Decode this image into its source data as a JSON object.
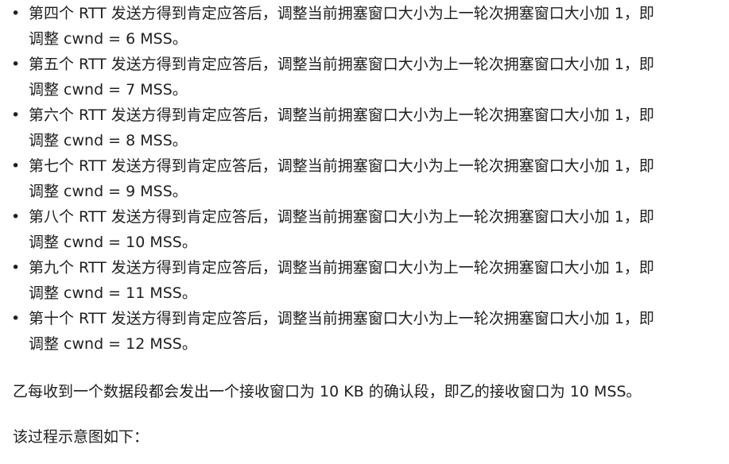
{
  "bullet_glyph": "•",
  "items": [
    {
      "line1": "第四个 RTT 发送方得到肯定应答后，调整当前拥塞窗口大小为上一轮次拥塞窗口大小加 1，即",
      "line2": "调整 cwnd = 6 MSS。"
    },
    {
      "line1": "第五个 RTT 发送方得到肯定应答后，调整当前拥塞窗口大小为上一轮次拥塞窗口大小加 1，即",
      "line2": "调整 cwnd = 7 MSS。"
    },
    {
      "line1": "第六个 RTT 发送方得到肯定应答后，调整当前拥塞窗口大小为上一轮次拥塞窗口大小加 1，即",
      "line2": "调整 cwnd = 8 MSS。"
    },
    {
      "line1": "第七个 RTT 发送方得到肯定应答后，调整当前拥塞窗口大小为上一轮次拥塞窗口大小加 1，即",
      "line2": "调整 cwnd = 9 MSS。"
    },
    {
      "line1": "第八个 RTT 发送方得到肯定应答后，调整当前拥塞窗口大小为上一轮次拥塞窗口大小加 1，即",
      "line2": "调整 cwnd = 10 MSS。"
    },
    {
      "line1": "第九个 RTT 发送方得到肯定应答后，调整当前拥塞窗口大小为上一轮次拥塞窗口大小加 1，即",
      "line2": "调整 cwnd = 11 MSS。"
    },
    {
      "line1": "第十个 RTT 发送方得到肯定应答后，调整当前拥塞窗口大小为上一轮次拥塞窗口大小加 1，即",
      "line2": "调整 cwnd = 12 MSS。"
    }
  ],
  "paragraph_receiver": "乙每收到一个数据段都会发出一个接收窗口为 10 KB 的确认段，即乙的接收窗口为 10 MSS。",
  "paragraph_diagram_intro": "该过程示意图如下："
}
